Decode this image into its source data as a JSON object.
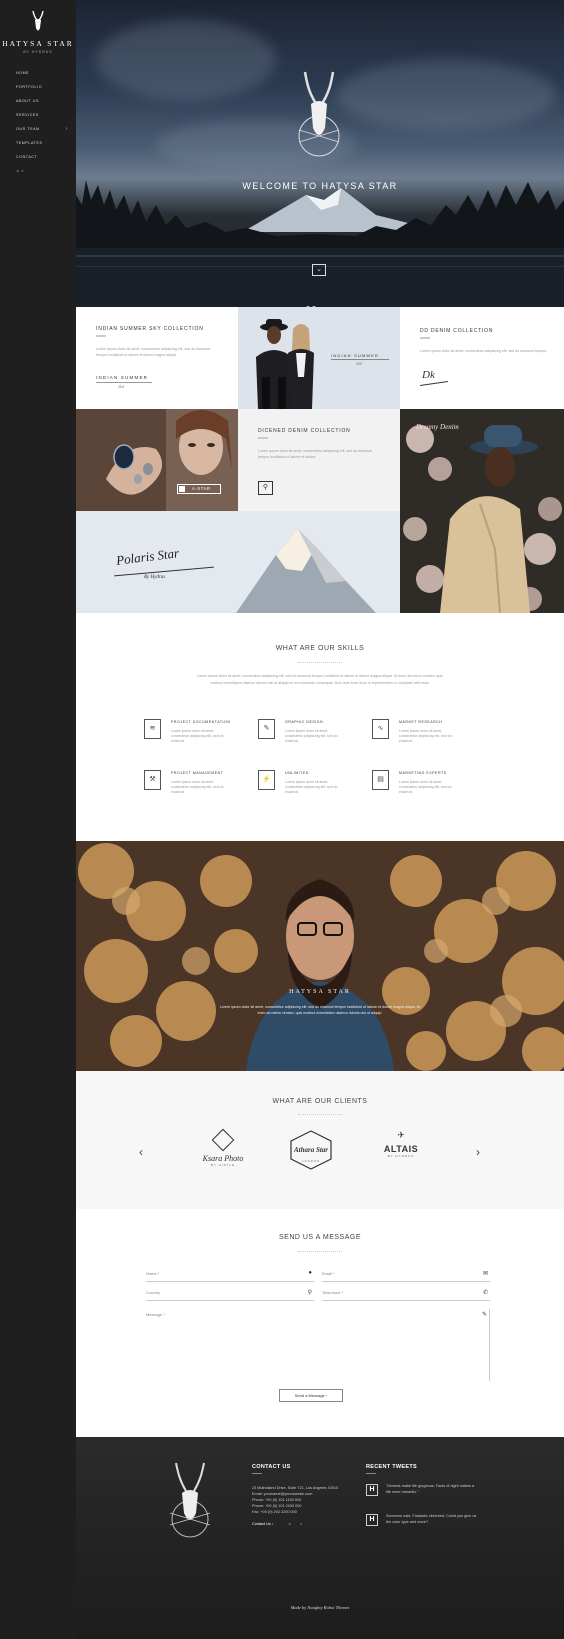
{
  "sidebar": {
    "logo_title": "HATYSA STAR",
    "logo_sub": "BY HYDRUS",
    "nav": [
      {
        "label": "Home"
      },
      {
        "label": "Portfolio"
      },
      {
        "label": "About Us"
      },
      {
        "label": "Services"
      },
      {
        "label": "Our Team"
      },
      {
        "label": "Templates"
      },
      {
        "label": "Contact"
      }
    ]
  },
  "hero": {
    "title": "WELCOME TO HATYSA STAR"
  },
  "grid": {
    "indian": {
      "heading": "INDIAN SUMMER SKY COLLECTION",
      "text": "Lorem ipsum dolor sit amet, consectetur adipiscing elit, sed do eiusmod tempor incididunt ut labore et dolore magna aliqua.",
      "caption": "INDIAN SUMMER",
      "year": "2k4"
    },
    "photo1_caption": "INDIAN SUMMER",
    "photo1_year": "2k4",
    "dd": {
      "heading": "DD DENIM COLLECTION",
      "text": "Lorem ipsum dolor sit amet, consectetur adipiscing elit, sed do eiusmod tempor.",
      "signature": "Dk"
    },
    "astar_label": "A-STAR",
    "dicened": {
      "heading": "DICENED DENIM COLLECTION",
      "text": "Lorem ipsum dolor sit amet, consectetur adipiscing elit, sed do eiusmod tempor incididunt ut labore et dolore."
    },
    "dream_sig": "Dreamy Denim",
    "polaris": "Polaris Star",
    "polaris_by": "By Hydrus"
  },
  "skills": {
    "title": "WHAT ARE OUR SKILLS",
    "intro": "Lorem ipsum dolor sit amet, consectetur adipiscing elit, sed do eiusmod tempor incididunt ut labore et dolore magna aliqua. Ut enim ad minim veniam, quis nostrud exercitation ullamco laboris nisi ut aliquip ex ea commodo consequat. Duis aute irure dolor in reprehenderit in voluptate velit esse.",
    "items": [
      {
        "title": "PROJECT DOCUMENTATION",
        "text": "Lorem ipsum dolor sit amet, consectetur adipiscing elit, sed do eiusmod.",
        "icon": "layers-icon",
        "glyph": "≋"
      },
      {
        "title": "GRAPHIC DESIGN",
        "text": "Lorem ipsum dolor sit amet, consectetur adipiscing elit, sed do eiusmod.",
        "icon": "pencil-icon",
        "glyph": "✎"
      },
      {
        "title": "MARKET RESEARCH",
        "text": "Lorem ipsum dolor sit amet, consectetur adipiscing elit, sed do eiusmod.",
        "icon": "chart-icon",
        "glyph": "∿"
      },
      {
        "title": "PROJECT MANAGEMENT",
        "text": "Lorem ipsum dolor sit amet, consectetur adipiscing elit, sed do eiusmod.",
        "icon": "compass-icon",
        "glyph": "⚒"
      },
      {
        "title": "UNLIMITED",
        "text": "Lorem ipsum dolor sit amet, consectetur adipiscing elit, sed do eiusmod.",
        "icon": "lightning-icon",
        "glyph": "⚡"
      },
      {
        "title": "MARKETING EXPERTS",
        "text": "Lorem ipsum dolor sit amet, consectetur adipiscing elit, sed do eiusmod.",
        "icon": "bars-icon",
        "glyph": "▤"
      }
    ]
  },
  "banner": {
    "logo": "HATYSA STAR",
    "text": "Lorem ipsum dolor sit amet, consectetur adipiscing elit, sed do eiusmod tempor incididunt ut labore et dolore magna aliqua. Ut enim ad minim veniam, quis nostrud exercitation ullamco laboris nisi ut aliquip."
  },
  "clients": {
    "title": "WHAT ARE OUR CLIENTS",
    "items": [
      {
        "name": "Ksara Photo",
        "sub": "BY HISTLE"
      },
      {
        "name": "Athara Star",
        "sub": "LONDON"
      },
      {
        "name": "ALTAIS",
        "sub": "BY HYDRUS"
      }
    ],
    "prev": "‹",
    "next": "›"
  },
  "contact_form": {
    "title": "SEND US A MESSAGE",
    "name_ph": "Name *",
    "email_ph": "Email *",
    "country_ph": "Country",
    "telephone_ph": "Telephone *",
    "message_ph": "Message *",
    "send": "Send a Message"
  },
  "footer": {
    "contact_title": "CONTACT US",
    "address": "23 Mulholland Drive, Suite 721, Los Angeles 10010",
    "email": "Email: yourname@yourdomain.com",
    "phone": "Phone: +00 (0) 101 1100 000",
    "phone2": "Phone: +00 (0) 101 2200 000",
    "fax": "Fax: +00 (0) 202 2200 000",
    "contact_link": "Contact Us",
    "tweets_title": "RECENT TWEETS",
    "tweet1": "\"Dreams make life gorgeous, Facts of night makes a life more romantic.\"",
    "tweet2": "Someone said, Fantastic sketched, Could you give us the color type and more?",
    "credit": "Made by Naughty Robot Themes"
  }
}
